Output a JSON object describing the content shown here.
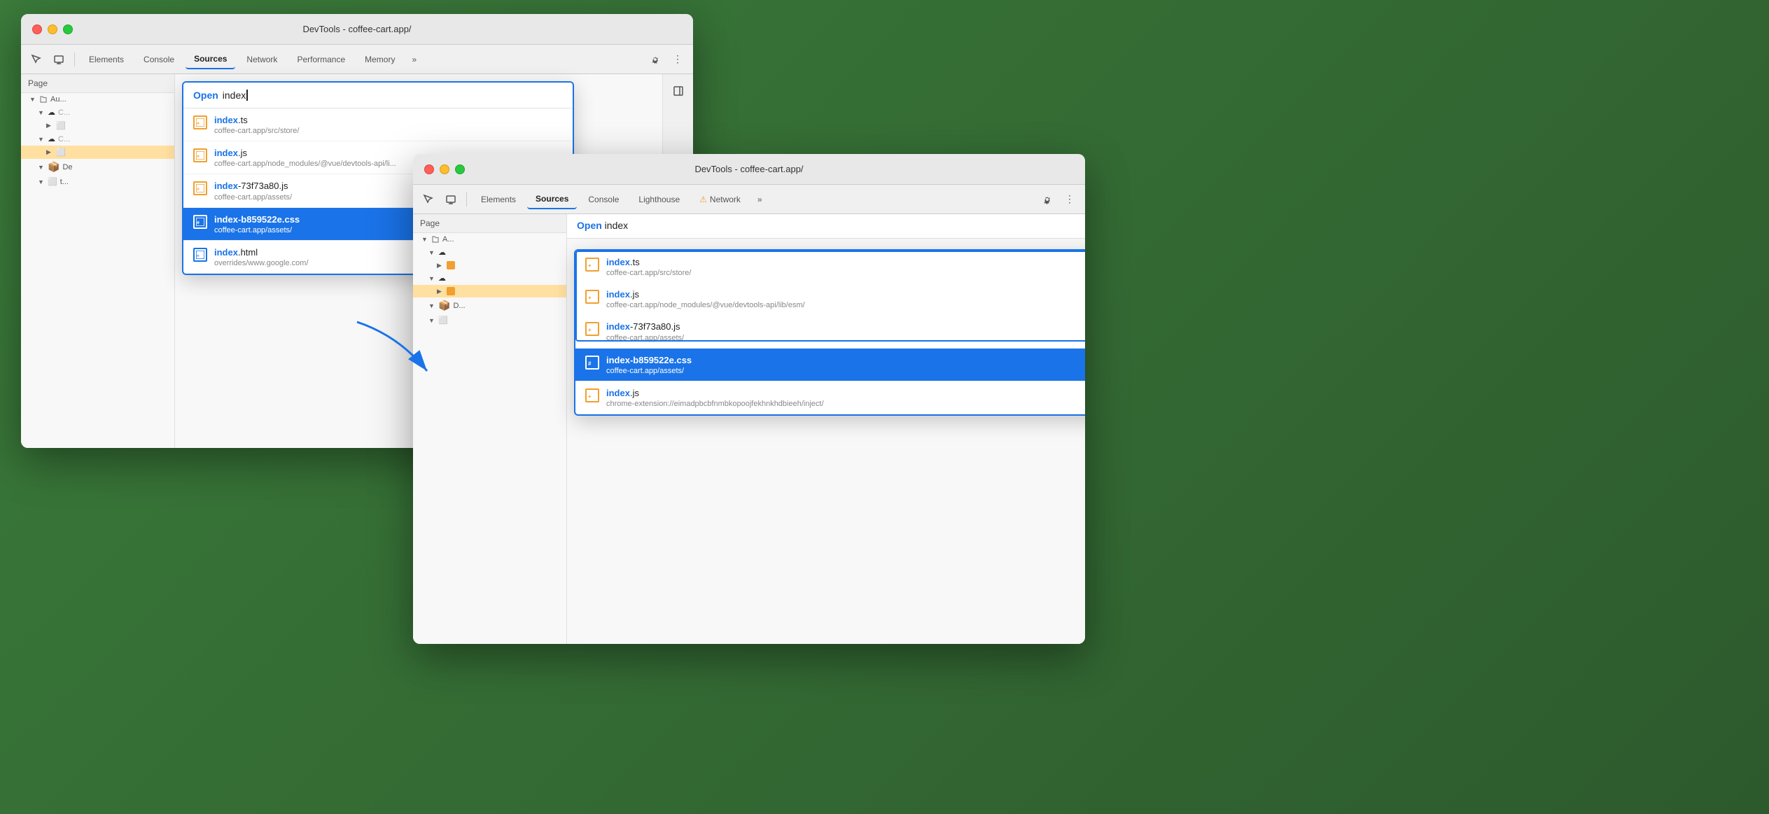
{
  "window1": {
    "title": "DevTools - coffee-cart.app/",
    "tabs": [
      {
        "label": "Elements",
        "active": false
      },
      {
        "label": "Console",
        "active": false
      },
      {
        "label": "Sources",
        "active": true
      },
      {
        "label": "Network",
        "active": false
      },
      {
        "label": "Performance",
        "active": false
      },
      {
        "label": "Memory",
        "active": false
      }
    ],
    "sidebar": {
      "header": "Page",
      "items": [
        "<> Au...",
        "cloud",
        "cloud",
        "box De",
        "t"
      ]
    },
    "openFile": {
      "label": "Open",
      "text": "index",
      "results": [
        {
          "icon": "ts",
          "name_bold": "index",
          "name_rest": ".ts",
          "path": "coffee-cart.app/src/store/",
          "selected": false
        },
        {
          "icon": "js",
          "name_bold": "index",
          "name_rest": ".js",
          "path": "coffee-cart.app/node_modules/@vue/devtools-api/li...",
          "selected": false
        },
        {
          "icon": "js",
          "name_bold": "index",
          "name_rest": "-73f73a80.js",
          "path": "coffee-cart.app/assets/",
          "selected": false
        },
        {
          "icon": "css",
          "name_bold": "index",
          "name_rest": "-b859522e.css",
          "path": "coffee-cart.app/assets/",
          "selected": true
        },
        {
          "icon": "html",
          "name_bold": "index",
          "name_rest": ".html",
          "path": "overrides/www.google.com/",
          "selected": false
        }
      ]
    }
  },
  "window2": {
    "title": "DevTools - coffee-cart.app/",
    "tabs": [
      {
        "label": "Elements",
        "active": false
      },
      {
        "label": "Sources",
        "active": true
      },
      {
        "label": "Console",
        "active": false
      },
      {
        "label": "Lighthouse",
        "active": false
      },
      {
        "label": "Network",
        "active": false,
        "warning": true
      }
    ],
    "sidebar": {
      "header": "Page"
    },
    "openFile": {
      "label": "Open",
      "text": "index",
      "results": [
        {
          "icon": "ts",
          "name_bold": "index",
          "name_rest": ".ts",
          "path": "coffee-cart.app/src/store/",
          "selected": false,
          "highlighted": true
        },
        {
          "icon": "js",
          "name_bold": "index",
          "name_rest": ".js",
          "path": "coffee-cart.app/node_modules/@vue/devtools-api/lib/esm/",
          "selected": false,
          "highlighted": true
        },
        {
          "icon": "js",
          "name_bold": "index",
          "name_rest": "-73f73a80.js",
          "path": "coffee-cart.app/assets/",
          "selected": false,
          "highlighted": false
        },
        {
          "icon": "css",
          "name_bold": "index",
          "name_rest": "-b859522e.css",
          "path": "coffee-cart.app/assets/",
          "selected": true,
          "highlighted": false
        },
        {
          "icon": "js",
          "name_bold": "index",
          "name_rest": ".js",
          "path": "chrome-extension://eimadpbcbfnmbkopoojfekhnkhdbieeh/inject/",
          "selected": false,
          "highlighted": false
        }
      ]
    }
  }
}
